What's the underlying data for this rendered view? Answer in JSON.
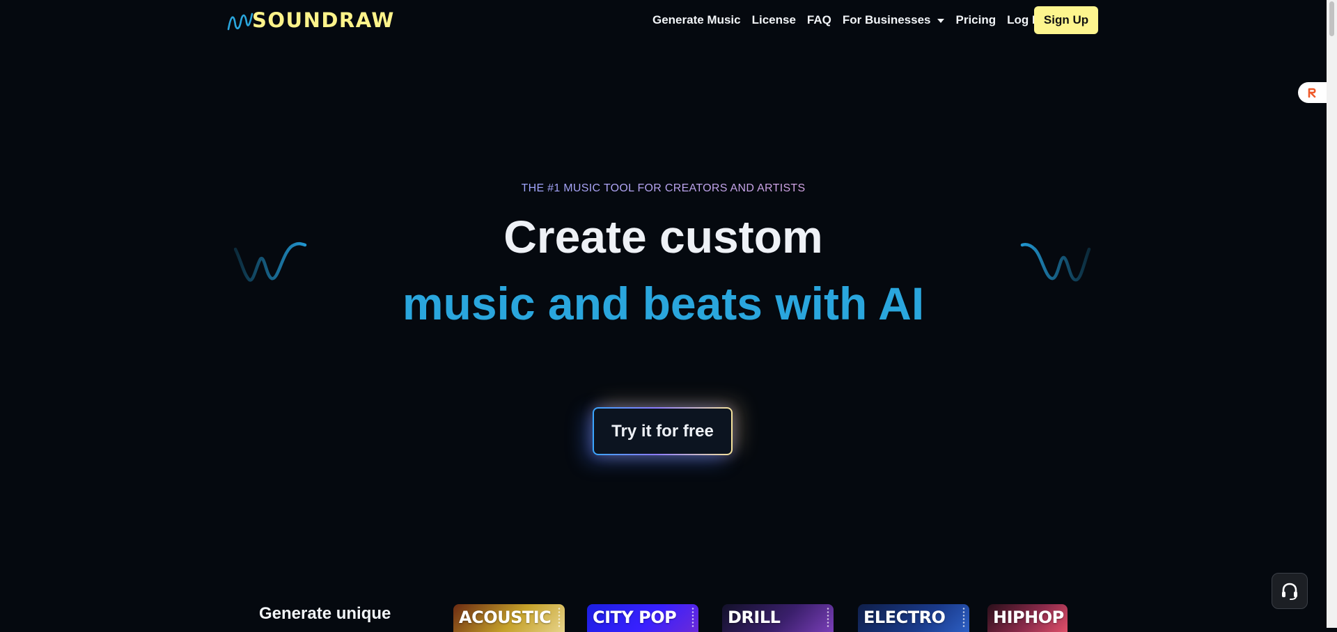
{
  "brand": {
    "name": "SOUNDRAW"
  },
  "nav": {
    "items": [
      "Generate Music",
      "License",
      "FAQ"
    ],
    "businesses": "For Businesses",
    "pricing": "Pricing",
    "login": "Log In",
    "signup": "Sign Up"
  },
  "hero": {
    "eyebrow": "THE #1 MUSIC TOOL FOR CREATORS AND ARTISTS",
    "title_line1": "Create custom",
    "title_line2": "music and beats with AI",
    "cta": "Try it for free"
  },
  "section": {
    "heading": "Generate unique",
    "genres": [
      "ACOUSTIC",
      "CITY POP",
      "DRILL",
      "ELECTRO",
      "HIPHOP"
    ]
  },
  "icons": {
    "logo_wave": "wave-logo-icon",
    "left_deco": "wave-icon",
    "right_deco": "wave-icon",
    "widget": "r-logo-icon",
    "support": "headset-icon",
    "caret": "chevron-down-icon"
  },
  "colors": {
    "background": "#05090f",
    "brand_yellow": "#fdf38a",
    "accent_blue": "#2aa6dd",
    "eyebrow": "#a89cf5"
  }
}
